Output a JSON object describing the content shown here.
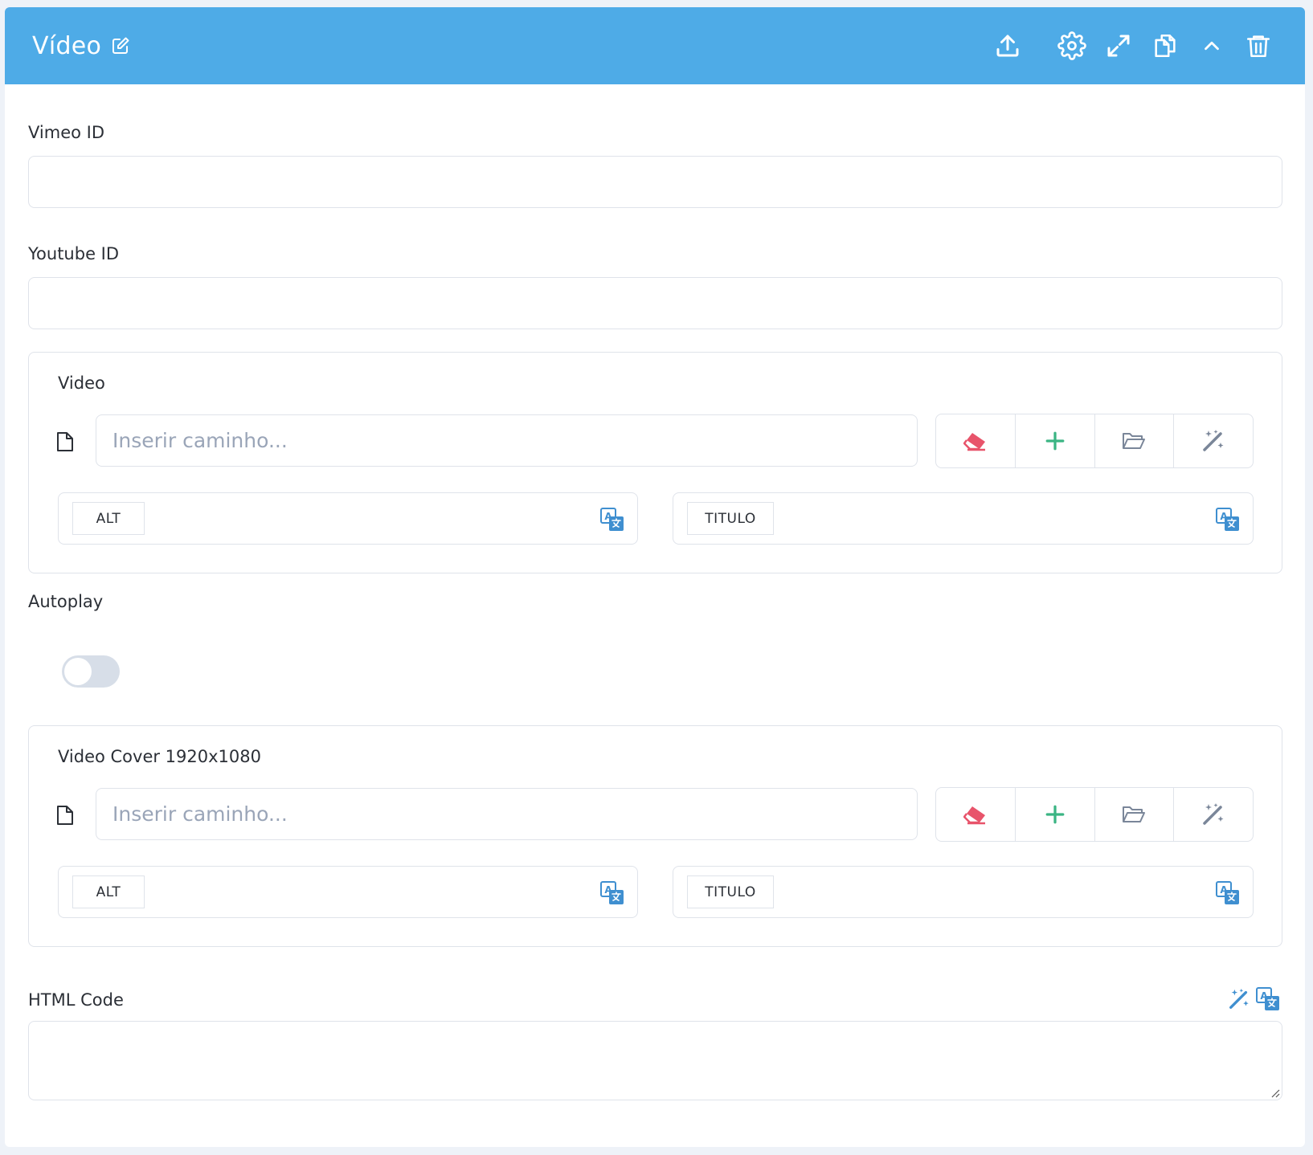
{
  "header": {
    "title": "Vídeo",
    "background": "#4eabe7",
    "icons": [
      "edit-icon",
      "upload-icon",
      "gear-icon",
      "expand-icon",
      "copy-icon",
      "chevron-up-icon",
      "trash-icon"
    ]
  },
  "fields": {
    "vimeo": {
      "label": "Vimeo ID",
      "value": ""
    },
    "youtube": {
      "label": "Youtube ID",
      "value": ""
    },
    "autoplay": {
      "label": "Autoplay",
      "checked": false
    },
    "html_code": {
      "label": "HTML Code",
      "value": ""
    }
  },
  "media": [
    {
      "label": "Video",
      "path_placeholder": "Inserir caminho...",
      "alt_label": "ALT",
      "title_label": "TITULO"
    },
    {
      "label": "Video Cover 1920x1080",
      "path_placeholder": "Inserir caminho...",
      "alt_label": "ALT",
      "title_label": "TITULO"
    }
  ],
  "colors": {
    "eraser": "#e8546b",
    "add": "#3bb583",
    "folder": "#7a8699",
    "magic": "#7a8699",
    "translate": "#3f8fd0",
    "border": "#dfe3ea"
  }
}
